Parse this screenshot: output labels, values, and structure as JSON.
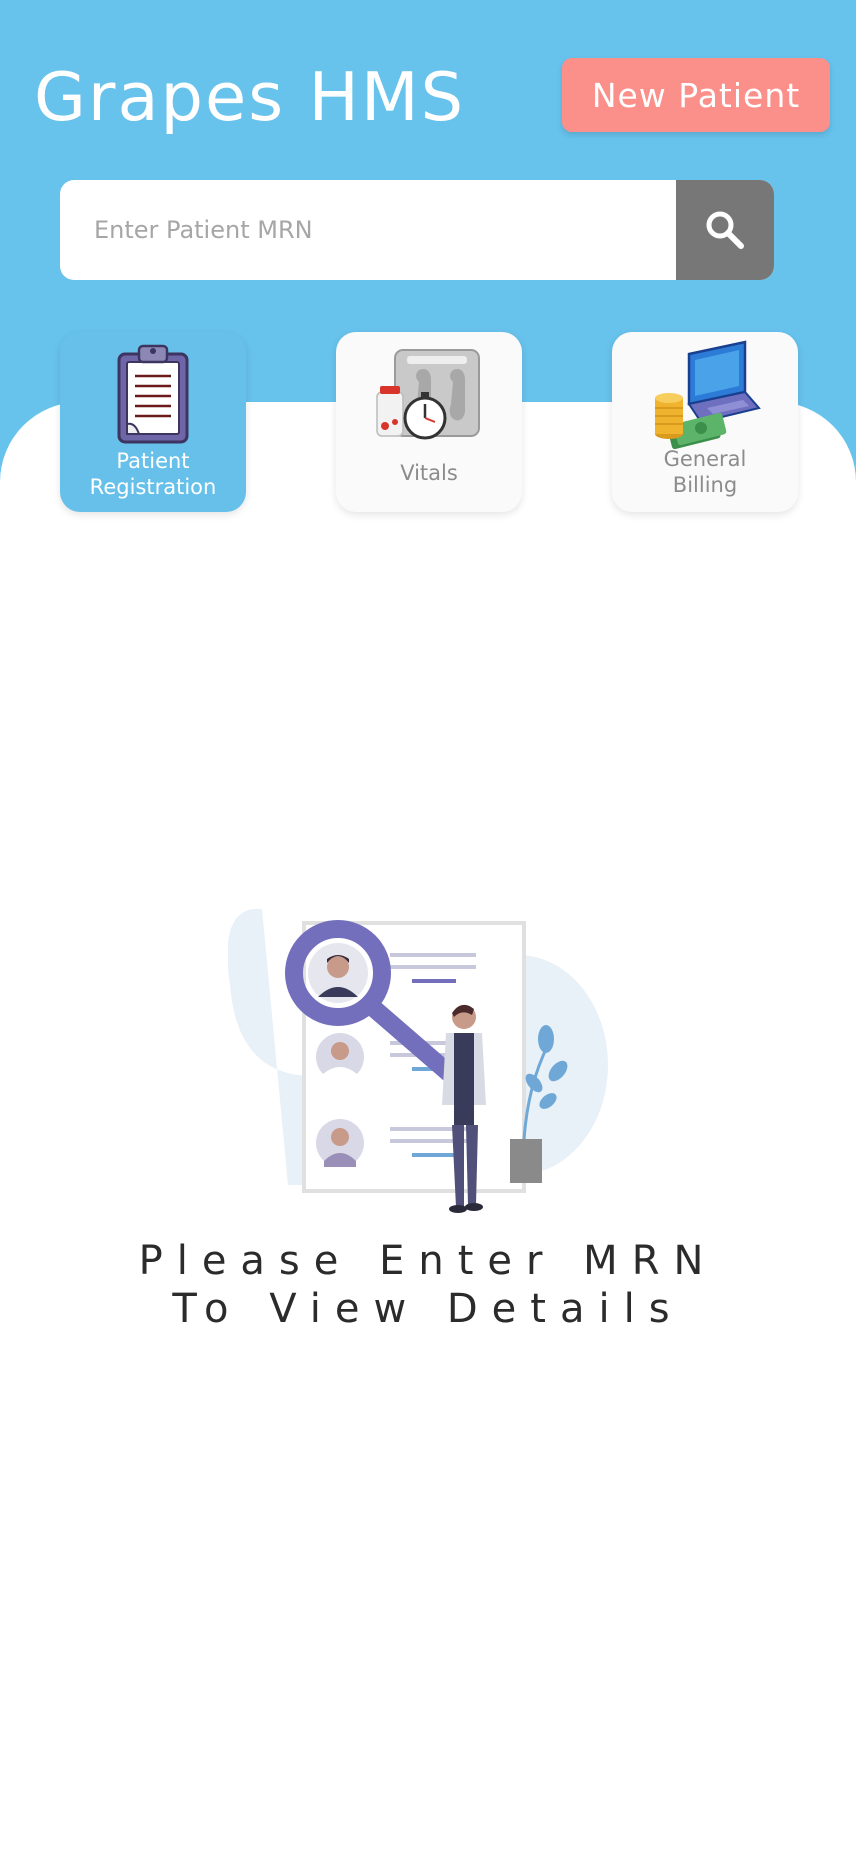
{
  "header": {
    "title": "Grapes HMS",
    "new_patient_label": "New Patient"
  },
  "search": {
    "placeholder": "Enter Patient MRN",
    "value": "",
    "button_icon": "search-icon"
  },
  "modules": [
    {
      "label_line1": "Patient",
      "label_line2": "Registration",
      "icon": "clipboard-icon",
      "active": true
    },
    {
      "label_line1": "Vitals",
      "label_line2": "",
      "icon": "weighing-scale-icon",
      "active": false
    },
    {
      "label_line1": "General",
      "label_line2": "Billing",
      "icon": "laptop-billing-icon",
      "active": false
    }
  ],
  "empty_state": {
    "line1": "Please Enter MRN",
    "line2": "To View Details",
    "illustration": "search-patient-records-illustration"
  },
  "colors": {
    "header_bg": "#67c2ec",
    "new_patient_bg": "#fb8f8a",
    "search_button_bg": "#777777",
    "active_card_bg": "#66c0ea",
    "illustration_accent": "#736fbc"
  }
}
